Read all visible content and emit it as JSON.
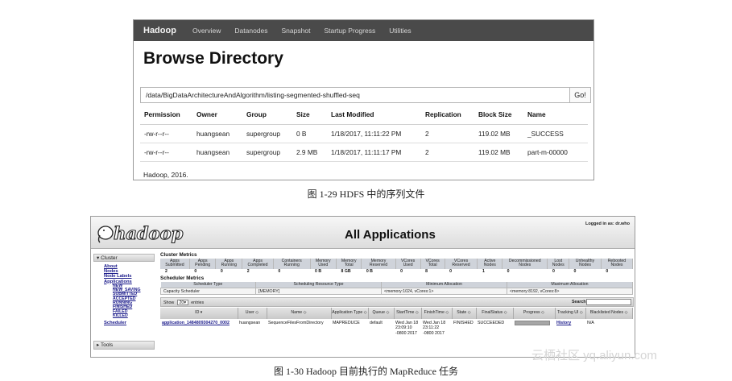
{
  "fig1": {
    "brand": "Hadoop",
    "nav": [
      "Overview",
      "Datanodes",
      "Snapshot",
      "Startup Progress",
      "Utilities"
    ],
    "title": "Browse Directory",
    "path_value": "/data/BigDataArchitectureAndAlgorithm/listing-segmented-shuffled-seq",
    "go_label": "Go!",
    "columns": [
      "Permission",
      "Owner",
      "Group",
      "Size",
      "Last Modified",
      "Replication",
      "Block Size",
      "Name"
    ],
    "rows": [
      [
        "-rw-r--r--",
        "huangsean",
        "supergroup",
        "0 B",
        "1/18/2017, 11:11:22 PM",
        "2",
        "119.02 MB",
        "_SUCCESS"
      ],
      [
        "-rw-r--r--",
        "huangsean",
        "supergroup",
        "2.9 MB",
        "1/18/2017, 11:11:17 PM",
        "2",
        "119.02 MB",
        "part-m-00000"
      ]
    ],
    "footer": "Hadoop, 2016.",
    "caption": "图 1-29    HDFS 中的序列文件"
  },
  "fig2": {
    "logo_text": "hadoop",
    "title": "All Applications",
    "logged_in": "Logged in as: dr.who",
    "sidebar": {
      "cluster_label": "Cluster",
      "links": [
        "About",
        "Nodes",
        "Node Labels",
        "Applications"
      ],
      "app_states": [
        "NEW",
        "NEW_SAVING",
        "SUBMITTED",
        "ACCEPTED",
        "RUNNING",
        "FINISHED",
        "FAILED",
        "KILLED"
      ],
      "scheduler": "Scheduler",
      "tools_label": "Tools"
    },
    "cluster_metrics_title": "Cluster Metrics",
    "metrics_headers": [
      "Apps Submitted",
      "Apps Pending",
      "Apps Running",
      "Apps Completed",
      "Containers Running",
      "Memory Used",
      "Memory Total",
      "Memory Reserved",
      "VCores Used",
      "VCores Total",
      "VCores Reserved",
      "Active Nodes",
      "Decommissioned Nodes",
      "Lost Nodes",
      "Unhealthy Nodes",
      "Rebooted Nodes"
    ],
    "metrics_values": [
      "2",
      "0",
      "0",
      "2",
      "0",
      "0 B",
      "8 GB",
      "0 B",
      "0",
      "8",
      "0",
      "1",
      "0",
      "0",
      "0",
      "0"
    ],
    "scheduler_metrics_title": "Scheduler Metrics",
    "scheduler_headers": [
      "Scheduler Type",
      "Scheduling Resource Type",
      "Minimum Allocation",
      "Maximum Allocation"
    ],
    "scheduler_values": [
      "Capacity Scheduler",
      "[MEMORY]",
      "<memory:1024, vCores:1>",
      "<memory:8192, vCores:8>"
    ],
    "show_label": "Show",
    "entries_value": "20",
    "entries_label": "entries",
    "search_label": "Search:",
    "apps_headers": [
      "ID",
      "User",
      "Name",
      "Application Type",
      "Queue",
      "StartTime",
      "FinishTime",
      "State",
      "FinalStatus",
      "Progress",
      "Tracking UI",
      "Blacklisted Nodes"
    ],
    "apps_row": {
      "id": "application_1484809304270_0002",
      "user": "huangsean",
      "name": "SequenceFilesFromDirectory",
      "type": "MAPREDUCE",
      "queue": "default",
      "start": "Wed Jan 18 23:09:10 -0800 2017",
      "finish": "Wed Jan 18 23:11:22 -0800 2017",
      "state": "FINISHED",
      "final_status": "SUCCEEDED",
      "progress_fraction": 1.0,
      "tracking": "History",
      "blacklisted": "N/A"
    },
    "caption": "图 1-30    Hadoop 目前执行的 MapReduce 任务"
  },
  "watermark": "云栖社区 yq.aliyun.com"
}
